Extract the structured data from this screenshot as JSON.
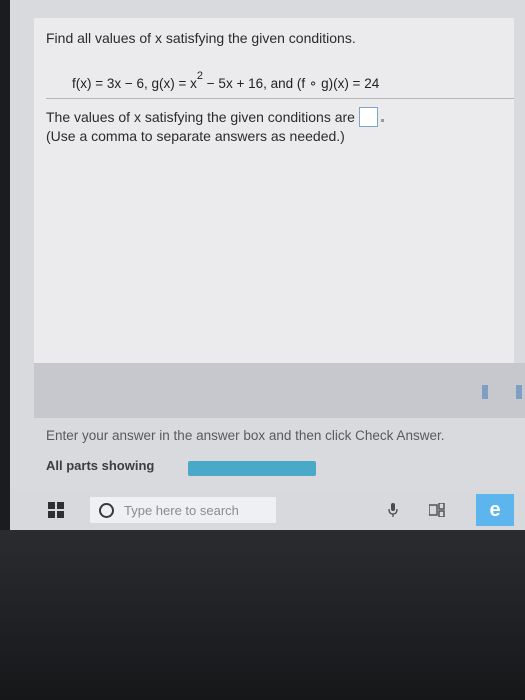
{
  "question": {
    "prompt": "Find all values of x satisfying the given conditions.",
    "equation_part1": "f(x) = 3x − 6, g(x) = x",
    "equation_exponent": "2",
    "equation_part2": " − 5x + 16, and (f ∘ g)(x) = 24",
    "answer_label": "The values of x satisfying the given conditions are",
    "answer_value": "",
    "hint": "(Use a comma to separate answers as needed.)"
  },
  "footer": {
    "instructions": "Enter your answer in the answer box and then click Check Answer.",
    "parts_label": "All parts showing",
    "progress_fraction": 1.0
  },
  "taskbar": {
    "search_placeholder": "Type here to search",
    "icons": [
      "windows-start-icon",
      "cortana-icon",
      "microphone-icon",
      "task-view-icon",
      "edge-browser-icon"
    ]
  },
  "colors": {
    "progress": "#4aa8c9",
    "edge": "#5cb5ec",
    "answer_box_border": "#7da4c9"
  }
}
